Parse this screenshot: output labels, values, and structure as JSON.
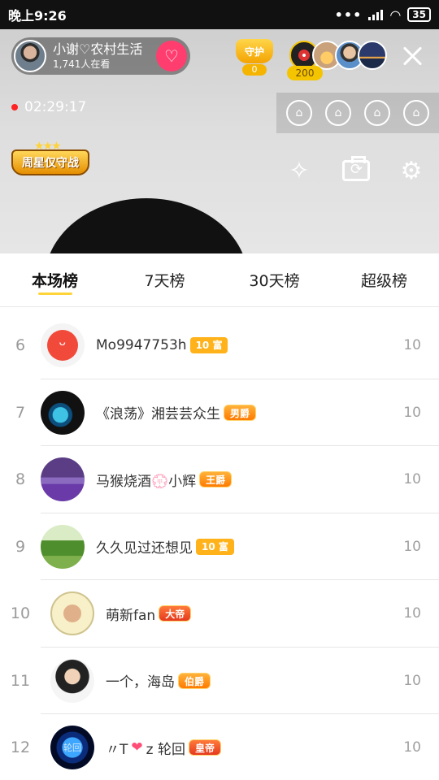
{
  "status_bar": {
    "time": "晚上9:26",
    "dots": "•••",
    "battery": "35"
  },
  "live": {
    "host_name": "小谢♡农村生活",
    "viewers": "1,741人在看",
    "guard_label": "守护",
    "guard_count": "0",
    "viewer_count": "200",
    "duration": "02:29:17",
    "weekly_badge": "周星仅守战"
  },
  "tabs": [
    {
      "label": "本场榜",
      "active": true
    },
    {
      "label": "7天榜"
    },
    {
      "label": "30天榜"
    },
    {
      "label": "超级榜"
    }
  ],
  "rows": [
    {
      "rank": "6",
      "name": "Mo9947753h",
      "tag": "10 富",
      "score": "10"
    },
    {
      "rank": "7",
      "name": "《浪荡》湘芸芸众生",
      "tag": "男爵",
      "score": "10"
    },
    {
      "rank": "8",
      "name": "马猴烧酒💮小辉",
      "tag": "王爵",
      "score": "10"
    },
    {
      "rank": "9",
      "name": "久久见过还想见",
      "tag": "10 富",
      "score": "10"
    },
    {
      "rank": "10",
      "name": "萌新fan",
      "tag": "大帝",
      "score": "10"
    },
    {
      "rank": "11",
      "name": "一个，海岛",
      "tag": "伯爵",
      "score": "10"
    },
    {
      "rank": "12",
      "name_prefix": "〃T",
      "name_suffix": "z 轮回",
      "tag": "皇帝",
      "score": "10"
    }
  ],
  "icons": [
    "heart-plus-icon",
    "close-icon",
    "sofa-seat-icon",
    "magic-wand-icon",
    "flip-camera-icon",
    "gear-icon"
  ]
}
